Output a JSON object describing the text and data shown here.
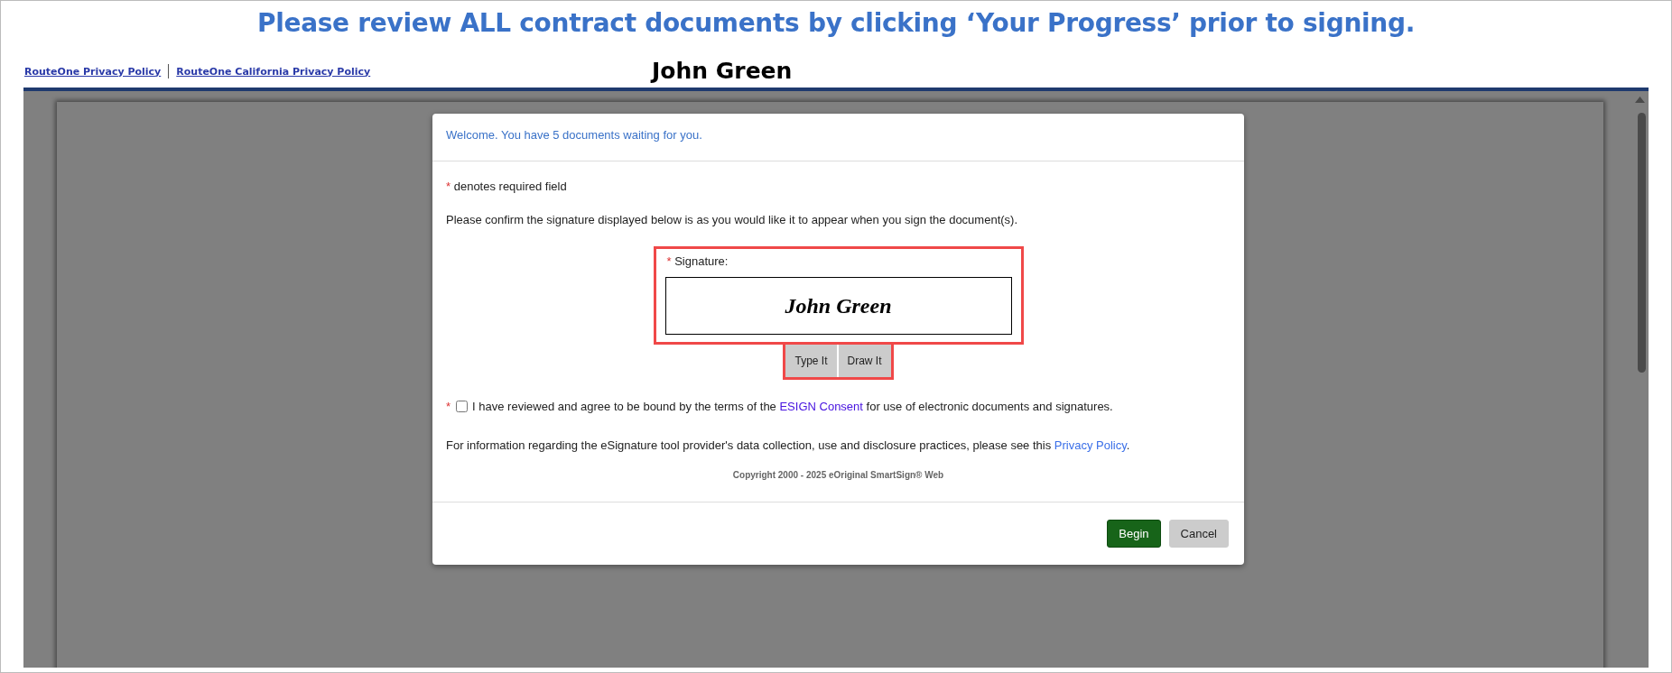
{
  "banner": {
    "text": "Please review ALL contract documents by clicking ‘Your Progress’ prior to signing."
  },
  "links": [
    {
      "label": "RouteOne Privacy Policy"
    },
    {
      "label": "RouteOne California Privacy Policy"
    }
  ],
  "signer_name": "John Green",
  "dialog": {
    "header": "Welcome. You have 5 documents waiting for you.",
    "required_note": {
      "marker": "*",
      "text": "denotes required field"
    },
    "instruction": "Please confirm the signature displayed below is as you would like it to appear when you sign the document(s).",
    "signature": {
      "marker": "*",
      "label": "Signature:",
      "value": "John Green"
    },
    "signature_modes": [
      {
        "label": "Type It"
      },
      {
        "label": "Draw It"
      }
    ],
    "agreement": {
      "marker": "*",
      "checked": false,
      "text_before": "I have reviewed and agree to be bound by the terms of the",
      "link": "ESIGN Consent",
      "text_after": "for use of electronic documents and signatures."
    },
    "privacy": {
      "text_before": "For information regarding the eSignature tool provider's data collection, use and disclosure practices, please see this",
      "link": "Privacy Policy",
      "text_after": "."
    },
    "copyright": "Copyright 2000 - 2025 eOriginal SmartSign® Web",
    "buttons": [
      {
        "label": "Begin",
        "kind": "primary"
      },
      {
        "label": "Cancel",
        "kind": "secondary"
      }
    ]
  }
}
